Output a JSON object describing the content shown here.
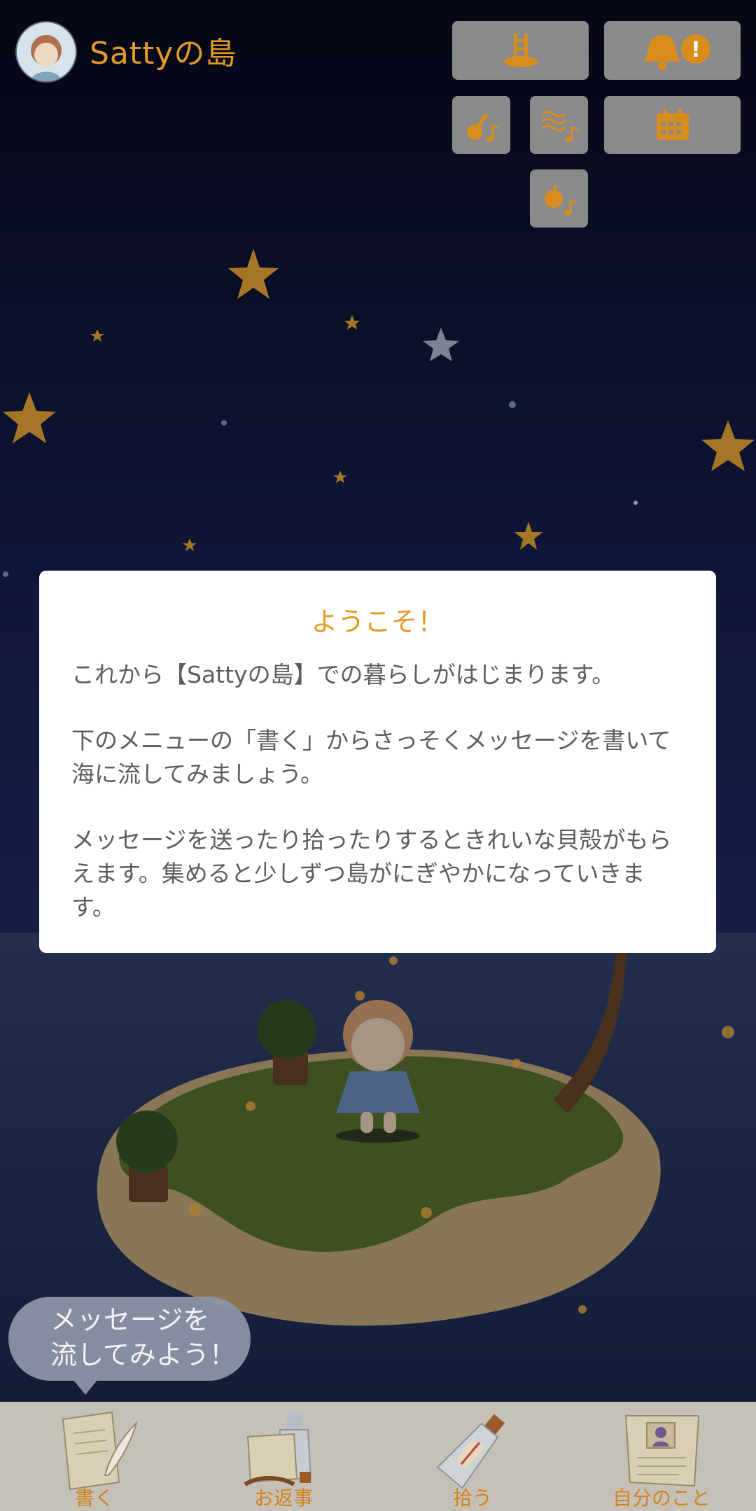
{
  "header": {
    "title": "Sattyの島"
  },
  "modal": {
    "title": "ようこそ！",
    "paragraphs": [
      "これから【Sattyの島】での暮らしがはじまります。",
      "下のメニューの「書く」からさっそくメッセージを書いて海に流してみましょう。",
      "メッセージを送ったり拾ったりするときれいな貝殻がもらえます。集めると少しずつ島がにぎやかになっていきます。"
    ]
  },
  "bubble": {
    "line1": "メッセージを",
    "line2": "流してみよう！"
  },
  "bottom_nav": [
    {
      "label": "書く",
      "icon": "letter-quill-icon"
    },
    {
      "label": "お返事",
      "icon": "bottle-letter-icon"
    },
    {
      "label": "拾う",
      "icon": "message-bottle-icon"
    },
    {
      "label": "自分のこと",
      "icon": "profile-paper-icon"
    }
  ],
  "colors": {
    "accent": "#e59b26",
    "modal_text": "#5d5d5d",
    "sky": "#0b0f2a",
    "sea": "#22304f"
  },
  "icons": {
    "ladder": "ladder-icon",
    "bell": "bell-icon",
    "alert": "alert-badge-icon",
    "guitar": "guitar-music-icon",
    "waves": "waves-music-icon",
    "calendar": "calendar-icon",
    "fruit": "fruit-music-icon"
  }
}
